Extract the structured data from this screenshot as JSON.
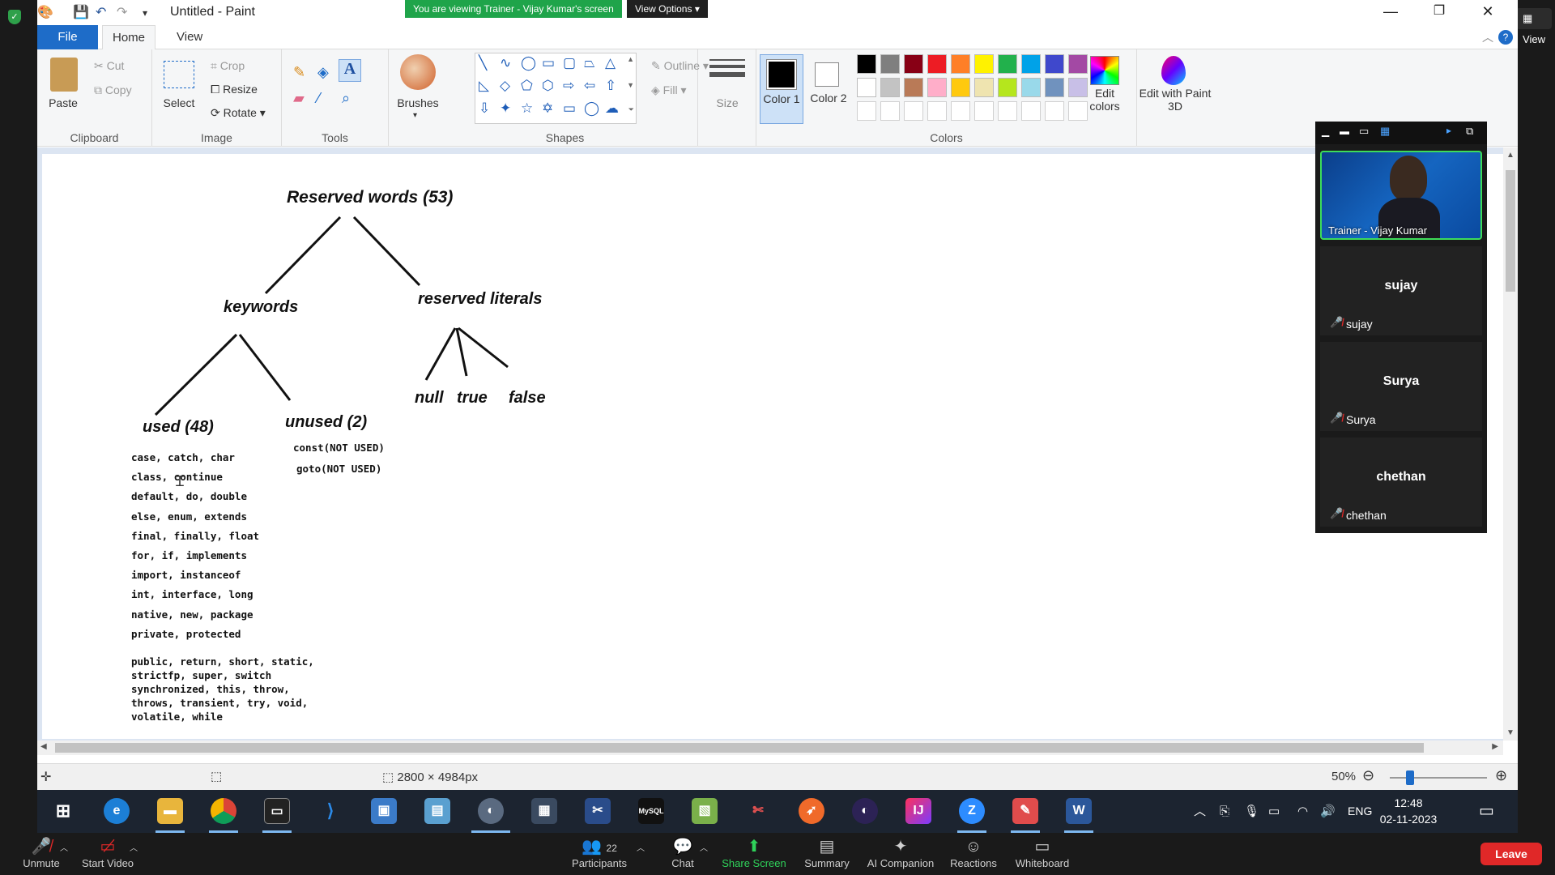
{
  "zoom": {
    "view_button": "View",
    "share_banner": "You are viewing Trainer - Vijay Kumar's screen",
    "view_options": "View Options",
    "toolbar": {
      "unmute": "Unmute",
      "start_video": "Start Video",
      "participants": "Participants",
      "participant_count": "22",
      "chat": "Chat",
      "share_screen": "Share Screen",
      "summary": "Summary",
      "ai_companion": "AI Companion",
      "reactions": "Reactions",
      "whiteboard": "Whiteboard",
      "leave": "Leave"
    },
    "gallery": {
      "presenter": "Trainer - Vijay Kumar",
      "participants": [
        {
          "display": "sujay",
          "name": "sujay"
        },
        {
          "display": "Surya",
          "name": "Surya"
        },
        {
          "display": "chethan",
          "name": "chethan"
        }
      ]
    }
  },
  "paint": {
    "title": "Untitled - Paint",
    "tabs": {
      "file": "File",
      "home": "Home",
      "view": "View"
    },
    "ribbon": {
      "clipboard": {
        "label": "Clipboard",
        "paste": "Paste",
        "cut": "Cut",
        "copy": "Copy"
      },
      "image": {
        "label": "Image",
        "select": "Select",
        "crop": "Crop",
        "resize": "Resize",
        "rotate": "Rotate"
      },
      "tools": {
        "label": "Tools"
      },
      "brushes": {
        "label": "Brushes"
      },
      "shapes": {
        "label": "Shapes",
        "outline": "Outline",
        "fill": "Fill"
      },
      "size": {
        "label": "Size"
      },
      "colors": {
        "label": "Colors",
        "color1": "Color 1",
        "color2": "Color 2",
        "edit_colors": "Edit colors",
        "palette_row1": [
          "#000000",
          "#7f7f7f",
          "#880015",
          "#ed1c24",
          "#ff7f27",
          "#fff200",
          "#22b14c",
          "#00a2e8",
          "#3f48cc",
          "#a349a4"
        ],
        "palette_row2": [
          "#ffffff",
          "#c3c3c3",
          "#b97a57",
          "#ffaec9",
          "#ffc90e",
          "#efe4b0",
          "#b5e61d",
          "#99d9ea",
          "#7092be",
          "#c8bfe7"
        ]
      },
      "paint3d": "Edit with Paint 3D"
    },
    "status": {
      "dimensions": "2800 × 4984px",
      "zoom": "50%"
    }
  },
  "diagram": {
    "root": "Reserved words (53)",
    "keywords": "keywords",
    "reserved_literals": "reserved literals",
    "used": "used (48)",
    "unused": "unused (2)",
    "literals": [
      "null",
      "true",
      "false"
    ],
    "unused_list": [
      "const(NOT USED)",
      "goto(NOT USED)"
    ],
    "used_list": [
      "case, catch, char",
      "class, continue",
      "default, do, double",
      "else, enum, extends",
      "final, finally, float",
      "for, if, implements",
      "import, instanceof",
      "int, interface, long",
      "native, new, package",
      "private, protected"
    ],
    "used_list_tail": [
      "public, return, short, static,",
      "strictfp, super, switch",
      "synchronized, this, throw,",
      "throws, transient, try, void,",
      "volatile, while"
    ]
  },
  "taskbar": {
    "lang": "ENG",
    "time": "12:48",
    "date": "02-11-2023"
  }
}
